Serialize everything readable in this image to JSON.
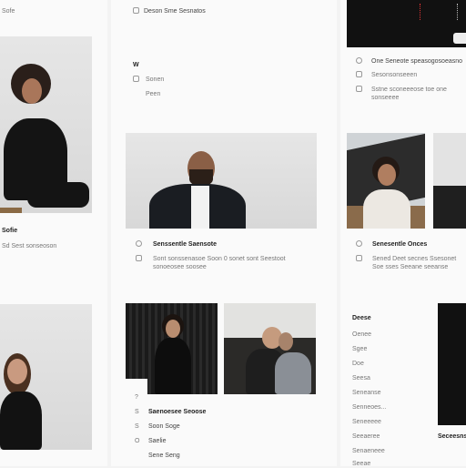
{
  "top_bar": {
    "left_label": "Sofe",
    "center_label": "Deson Sme Sesnatos"
  },
  "nav": {
    "items": [
      "W",
      "Sonen",
      "Peen"
    ]
  },
  "cards": [
    {
      "title": "Sofie",
      "subtitle": "Sd Sest sonseoson"
    },
    {
      "title": "Senssentle Saensote",
      "desc": "Sont sonssenasoe Soon 0 sonet sont Seestoot sonoeosee soosee"
    },
    {
      "title": "Senesentle Onces",
      "desc": "Sened Deet secnes Ssesonet Soe sses Seeane seeanse"
    },
    {
      "title": "One Seneote speasogosoeasno",
      "desc": "Sesonsonseeen",
      "desc2": "Sstne sconeeeose toe one sonseeee"
    }
  ],
  "bottom_list": {
    "items": [
      {
        "icon": "?",
        "label": "Saenoesee Seoose"
      },
      {
        "icon": "S",
        "label": "Soon Soge"
      },
      {
        "icon": "S",
        "label": "Saelie"
      },
      {
        "icon": "O",
        "label": "Sene Seng"
      }
    ]
  },
  "side_list": {
    "heading": "Deese",
    "items": [
      "Oenee",
      "Sgee",
      "Doe",
      "Seesa",
      "Seneanse",
      "Senneoes...",
      "Seneeeee",
      "Seeaeree",
      "Senaeneee",
      "Seeae"
    ]
  },
  "right_bottom_label": "Seceesnsd"
}
